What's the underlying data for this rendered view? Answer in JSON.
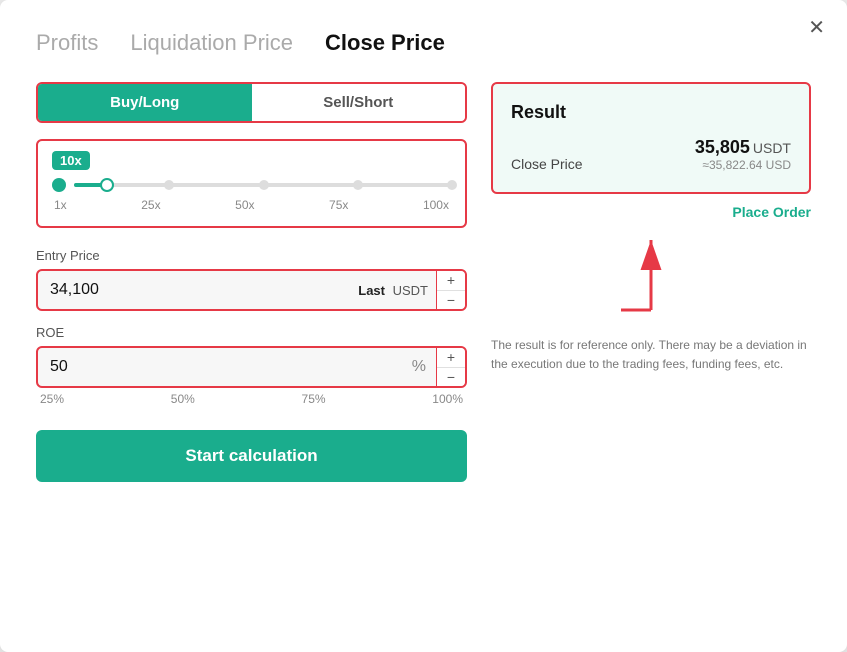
{
  "modal": {
    "close_label": "✕"
  },
  "tabs": [
    {
      "id": "profits",
      "label": "Profits",
      "active": false
    },
    {
      "id": "liquidation",
      "label": "Liquidation Price",
      "active": false
    },
    {
      "id": "close_price",
      "label": "Close Price",
      "active": true
    }
  ],
  "left": {
    "buy_label": "Buy/Long",
    "sell_label": "Sell/Short",
    "leverage_badge": "10x",
    "leverage_marks": [
      "1x",
      "25x",
      "50x",
      "75x",
      "100x"
    ],
    "entry_price_label": "Entry Price",
    "entry_price_value": "34,100",
    "entry_price_suffix": "Last USDT",
    "entry_price_suffix_bold": "Last",
    "roe_label": "ROE",
    "roe_value": "50",
    "roe_unit": "%",
    "roe_marks": [
      "25%",
      "50%",
      "75%",
      "100%"
    ],
    "calc_button": "Start calculation",
    "stepper_plus": "+",
    "stepper_minus": "−"
  },
  "right": {
    "result_title": "Result",
    "close_price_label": "Close Price",
    "close_price_value": "35,805",
    "close_price_unit": "USDT",
    "close_price_approx": "≈35,822.64 USD",
    "place_order": "Place Order",
    "disclaimer": "The result is for reference only. There may be a deviation in the execution due to the trading fees, funding fees, etc."
  }
}
